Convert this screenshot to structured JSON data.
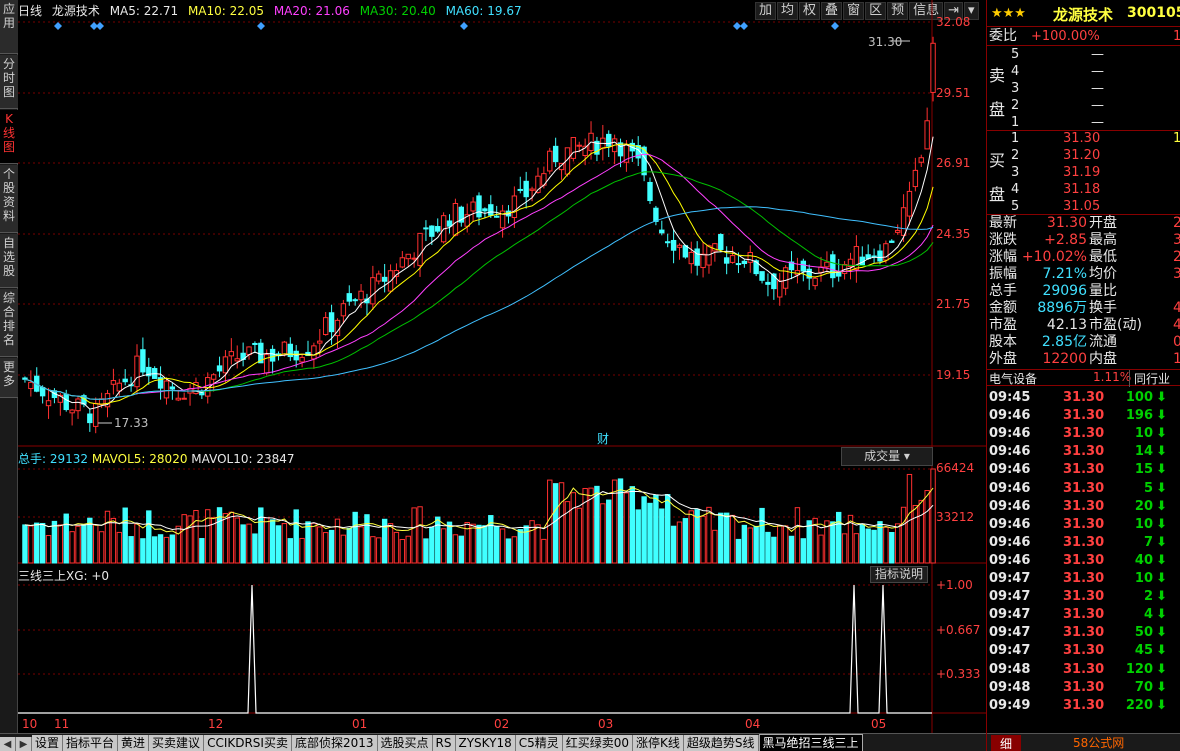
{
  "left_tabs": [
    "应用",
    "分时图",
    "K线图",
    "个股资料",
    "自选股",
    "综合排名",
    "更多"
  ],
  "info": {
    "period": "日线",
    "stock_name": "龙源技术",
    "ma5": "MA5: 22.71",
    "ma10": "MA10: 22.05",
    "ma20": "MA20: 21.06",
    "ma30": "MA30: 20.40",
    "ma60": "MA60: 19.67"
  },
  "toolbar": [
    "加",
    "均",
    "权",
    "叠",
    "窗",
    "区",
    "预",
    "信息"
  ],
  "price_axis": [
    "32.08",
    "29.51",
    "26.91",
    "24.35",
    "21.75",
    "19.15"
  ],
  "annotations": {
    "high": "31.30",
    "low": "17.33",
    "cai": "财"
  },
  "volume": {
    "header": "总手: 29132",
    "mavol5": "MAVOL5: 28020",
    "mavol10": "MAVOL10: 23847",
    "selector": "成交量",
    "axis": [
      "66424",
      "33212"
    ]
  },
  "indicator": {
    "header": "三线三上XG: +0",
    "button": "指标说明",
    "axis": [
      "+1.00",
      "+0.667",
      "+0.333"
    ]
  },
  "date_axis": [
    "10",
    "11",
    "12",
    "01",
    "02",
    "03",
    "04",
    "05"
  ],
  "bottom_tabs": [
    "设置",
    "指标平台",
    "黄进",
    "买卖建议",
    "CCIKDRSI买卖",
    "底部侦探2013",
    "选股买点",
    "RS",
    "ZYSKY18",
    "C5精灵",
    "红买绿卖00",
    "涨停K线",
    "超级趋势S线",
    "黑马绝招三线三上"
  ],
  "quote": {
    "title": "龙源技术",
    "code": "300105",
    "weibi_label": "委比",
    "weibi_value": "+100.00%",
    "weibi_extra": "1",
    "sell_label": [
      "卖",
      "盘"
    ],
    "buy_label": [
      "买",
      "盘"
    ],
    "sell": [
      {
        "n": "5",
        "p": "—"
      },
      {
        "n": "4",
        "p": "—"
      },
      {
        "n": "3",
        "p": "—"
      },
      {
        "n": "2",
        "p": "—"
      },
      {
        "n": "1",
        "p": "—"
      }
    ],
    "buy": [
      {
        "n": "1",
        "p": "31.30",
        "v": "1"
      },
      {
        "n": "2",
        "p": "31.20",
        "v": ""
      },
      {
        "n": "3",
        "p": "31.19",
        "v": ""
      },
      {
        "n": "4",
        "p": "31.18",
        "v": ""
      },
      {
        "n": "5",
        "p": "31.05",
        "v": ""
      }
    ],
    "stats": [
      {
        "l": "最新",
        "v": "31.30",
        "vc": "red",
        "l2": "开盘",
        "v2": "2"
      },
      {
        "l": "涨跌",
        "v": "+2.85",
        "vc": "red",
        "l2": "最高",
        "v2": "3"
      },
      {
        "l": "涨幅",
        "v": "+10.02%",
        "vc": "red",
        "l2": "最低",
        "v2": "2"
      },
      {
        "l": "振幅",
        "v": "7.21%",
        "vc": "cyan",
        "l2": "均价",
        "v2": "3"
      },
      {
        "l": "总手",
        "v": "29096",
        "vc": "cyan",
        "l2": "量比",
        "v2": ""
      },
      {
        "l": "金额",
        "v": "8896万",
        "vc": "cyan",
        "l2": "换手",
        "v2": "4"
      },
      {
        "l": "市盈",
        "v": "42.13",
        "vc": "white",
        "l2": "市盈(动)",
        "v2": "4"
      },
      {
        "l": "股本",
        "v": "2.85亿",
        "vc": "cyan",
        "l2": "流通",
        "v2": "0."
      },
      {
        "l": "外盘",
        "v": "12200",
        "vc": "red",
        "l2": "内盘",
        "v2": "1"
      }
    ],
    "industry": "电气设备",
    "industry_pct": "1.11%",
    "industry_btn": "同行业",
    "ticks": [
      {
        "t": "09:45",
        "p": "31.30",
        "v": "100"
      },
      {
        "t": "09:46",
        "p": "31.30",
        "v": "196"
      },
      {
        "t": "09:46",
        "p": "31.30",
        "v": "10"
      },
      {
        "t": "09:46",
        "p": "31.30",
        "v": "14"
      },
      {
        "t": "09:46",
        "p": "31.30",
        "v": "15"
      },
      {
        "t": "09:46",
        "p": "31.30",
        "v": "5"
      },
      {
        "t": "09:46",
        "p": "31.30",
        "v": "20"
      },
      {
        "t": "09:46",
        "p": "31.30",
        "v": "10"
      },
      {
        "t": "09:46",
        "p": "31.30",
        "v": "7"
      },
      {
        "t": "09:46",
        "p": "31.30",
        "v": "40"
      },
      {
        "t": "09:47",
        "p": "31.30",
        "v": "10"
      },
      {
        "t": "09:47",
        "p": "31.30",
        "v": "2"
      },
      {
        "t": "09:47",
        "p": "31.30",
        "v": "4"
      },
      {
        "t": "09:47",
        "p": "31.30",
        "v": "50"
      },
      {
        "t": "09:47",
        "p": "31.30",
        "v": "45"
      },
      {
        "t": "09:48",
        "p": "31.30",
        "v": "120"
      },
      {
        "t": "09:48",
        "p": "31.30",
        "v": "70"
      },
      {
        "t": "09:49",
        "p": "31.30",
        "v": "220"
      }
    ],
    "footer_tab": "细",
    "watermark": "58公式网"
  },
  "colors": {
    "up": "#ff3030",
    "down": "#40ffff",
    "ma5": "#ffffff",
    "ma10": "#ffff00",
    "ma20": "#ff40ff",
    "ma30": "#00c000",
    "ma60": "#40c0ff"
  }
}
